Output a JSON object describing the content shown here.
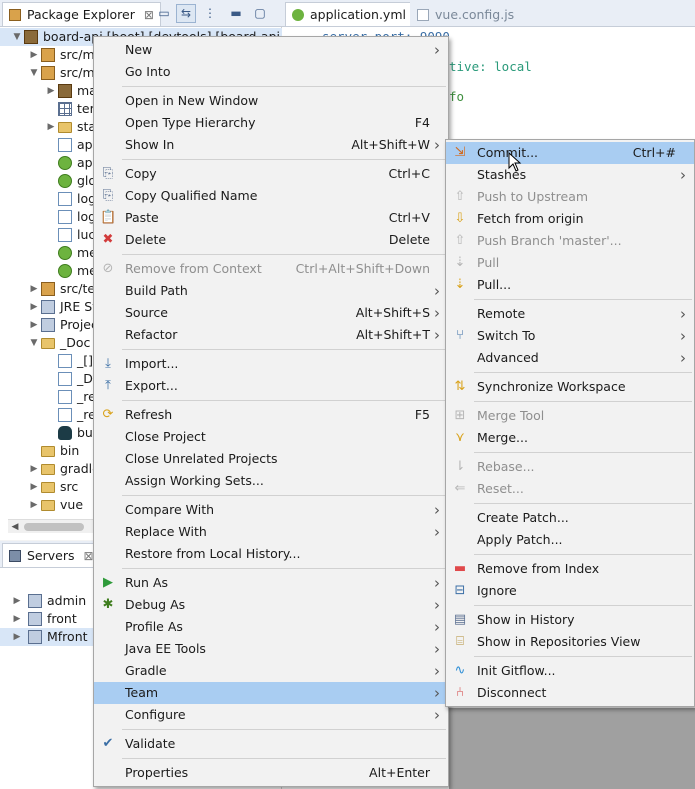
{
  "package_explorer": {
    "tab_label": "Package Explorer",
    "close_glyph": "⊠",
    "toolbar": [
      "collapse-all-icon",
      "link-with-editor-icon",
      "view-menu-icon",
      "minimize-icon",
      "maximize-icon"
    ],
    "tree": [
      {
        "text": "board-api [boot] [devtools] [board-api",
        "indent": 0,
        "twisty": "▼",
        "icon": "project-icon",
        "selected": true
      },
      {
        "text": "src/m",
        "indent": 1,
        "twisty": "▶",
        "icon": "source-folder-icon"
      },
      {
        "text": "src/m",
        "indent": 1,
        "twisty": "▼",
        "icon": "source-folder-icon"
      },
      {
        "text": "ma",
        "indent": 2,
        "twisty": "▶",
        "icon": "package-icon"
      },
      {
        "text": "ter",
        "indent": 2,
        "twisty": "",
        "icon": "grid-icon"
      },
      {
        "text": "sta",
        "indent": 2,
        "twisty": "▶",
        "icon": "folder-icon"
      },
      {
        "text": "ap",
        "indent": 2,
        "twisty": "",
        "icon": "file-icon"
      },
      {
        "text": "ap",
        "indent": 2,
        "twisty": "",
        "icon": "spring-icon"
      },
      {
        "text": "glo",
        "indent": 2,
        "twisty": "",
        "icon": "spring-icon"
      },
      {
        "text": "log",
        "indent": 2,
        "twisty": "",
        "icon": "file-icon"
      },
      {
        "text": "log",
        "indent": 2,
        "twisty": "",
        "icon": "xml-file-icon"
      },
      {
        "text": "luc",
        "indent": 2,
        "twisty": "",
        "icon": "file-icon"
      },
      {
        "text": "me",
        "indent": 2,
        "twisty": "",
        "icon": "spring-icon"
      },
      {
        "text": "me",
        "indent": 2,
        "twisty": "",
        "icon": "spring-icon"
      },
      {
        "text": "src/te",
        "indent": 1,
        "twisty": "▶",
        "icon": "source-folder-icon"
      },
      {
        "text": "JRE Sy",
        "indent": 1,
        "twisty": "▶",
        "icon": "library-icon"
      },
      {
        "text": "Projec",
        "indent": 1,
        "twisty": "▶",
        "icon": "library-icon"
      },
      {
        "text": "_Doc",
        "indent": 1,
        "twisty": "▼",
        "icon": "folder-icon"
      },
      {
        "text": "_[]",
        "indent": 2,
        "twisty": "",
        "icon": "file-icon"
      },
      {
        "text": "_D",
        "indent": 2,
        "twisty": "",
        "icon": "xml-file-icon"
      },
      {
        "text": "_re",
        "indent": 2,
        "twisty": "",
        "icon": "file-icon"
      },
      {
        "text": "_re",
        "indent": 2,
        "twisty": "",
        "icon": "file-icon"
      },
      {
        "text": "bu",
        "indent": 2,
        "twisty": "",
        "icon": "gradle-icon"
      },
      {
        "text": "bin",
        "indent": 1,
        "twisty": "",
        "icon": "folder-icon"
      },
      {
        "text": "gradle",
        "indent": 1,
        "twisty": "▶",
        "icon": "folder-icon"
      },
      {
        "text": "src",
        "indent": 1,
        "twisty": "▶",
        "icon": "folder-icon"
      },
      {
        "text": "vue",
        "indent": 1,
        "twisty": "▶",
        "icon": "folder-icon"
      }
    ]
  },
  "servers": {
    "tab_label": "Servers",
    "close_glyph": "⊠",
    "items": [
      {
        "text": "admin",
        "suffix": "[",
        "icon": "server-icon"
      },
      {
        "text": "front",
        "suffix": "[S",
        "icon": "server-icon"
      },
      {
        "text": "Mfront",
        "suffix": "",
        "icon": "server-icon",
        "selected": true
      }
    ]
  },
  "editor": {
    "tabs": [
      {
        "label": "application.yml",
        "close_glyph": "⊠",
        "active": true
      },
      {
        "label": "vue.config.js",
        "active": false
      }
    ],
    "code_lines": [
      {
        "text": "server.port: 9090",
        "kind": "key"
      },
      {
        "text": "tive: local",
        "kind": "value"
      },
      {
        "text": "fo",
        "kind": "comment"
      }
    ]
  },
  "context_menu": {
    "groups": [
      [
        {
          "label": "New",
          "submenu": true
        },
        {
          "label": "Go Into"
        }
      ],
      [
        {
          "label": "Open in New Window"
        },
        {
          "label": "Open Type Hierarchy",
          "shortcut": "F4"
        },
        {
          "label": "Show In",
          "shortcut": "Alt+Shift+W",
          "submenu": true
        }
      ],
      [
        {
          "label": "Copy",
          "shortcut": "Ctrl+C",
          "icon": "copy-icon"
        },
        {
          "label": "Copy Qualified Name",
          "icon": "copy-icon"
        },
        {
          "label": "Paste",
          "shortcut": "Ctrl+V",
          "icon": "paste-icon"
        },
        {
          "label": "Delete",
          "shortcut": "Delete",
          "icon": "delete-icon"
        }
      ],
      [
        {
          "label": "Remove from Context",
          "shortcut": "Ctrl+Alt+Shift+Down",
          "disabled": true,
          "icon": "remove-context-icon"
        },
        {
          "label": "Build Path",
          "submenu": true
        },
        {
          "label": "Source",
          "shortcut": "Alt+Shift+S",
          "submenu": true
        },
        {
          "label": "Refactor",
          "shortcut": "Alt+Shift+T",
          "submenu": true
        }
      ],
      [
        {
          "label": "Import...",
          "icon": "import-icon"
        },
        {
          "label": "Export...",
          "icon": "export-icon"
        }
      ],
      [
        {
          "label": "Refresh",
          "shortcut": "F5",
          "icon": "refresh-icon"
        },
        {
          "label": "Close Project"
        },
        {
          "label": "Close Unrelated Projects"
        },
        {
          "label": "Assign Working Sets..."
        }
      ],
      [
        {
          "label": "Compare With",
          "submenu": true
        },
        {
          "label": "Replace With",
          "submenu": true
        },
        {
          "label": "Restore from Local History..."
        }
      ],
      [
        {
          "label": "Run As",
          "submenu": true,
          "icon": "run-icon"
        },
        {
          "label": "Debug As",
          "submenu": true,
          "icon": "debug-icon"
        },
        {
          "label": "Profile As",
          "submenu": true
        },
        {
          "label": "Java EE Tools",
          "submenu": true
        },
        {
          "label": "Gradle",
          "submenu": true
        },
        {
          "label": "Team",
          "submenu": true,
          "selected": true
        },
        {
          "label": "Configure",
          "submenu": true
        }
      ],
      [
        {
          "label": "Validate",
          "icon": "check-icon"
        }
      ],
      [
        {
          "label": "Properties",
          "shortcut": "Alt+Enter"
        }
      ]
    ]
  },
  "team_submenu": {
    "groups": [
      [
        {
          "label": "Commit...",
          "shortcut": "Ctrl+#",
          "selected": true,
          "icon": "commit-icon"
        },
        {
          "label": "Stashes",
          "submenu": true
        },
        {
          "label": "Push to Upstream",
          "disabled": true,
          "icon": "push-icon"
        },
        {
          "label": "Fetch from origin",
          "icon": "fetch-icon"
        },
        {
          "label": "Push Branch 'master'...",
          "disabled": true,
          "icon": "push-icon"
        },
        {
          "label": "Pull",
          "disabled": true,
          "icon": "pull-icon"
        },
        {
          "label": "Pull...",
          "icon": "pull-icon"
        }
      ],
      [
        {
          "label": "Remote",
          "submenu": true
        },
        {
          "label": "Switch To",
          "submenu": true,
          "icon": "switch-branch-icon"
        },
        {
          "label": "Advanced",
          "submenu": true
        }
      ],
      [
        {
          "label": "Synchronize Workspace",
          "icon": "synchronize-icon"
        }
      ],
      [
        {
          "label": "Merge Tool",
          "disabled": true,
          "icon": "merge-tool-icon"
        },
        {
          "label": "Merge...",
          "icon": "merge-icon"
        }
      ],
      [
        {
          "label": "Rebase...",
          "disabled": true,
          "icon": "rebase-icon"
        },
        {
          "label": "Reset...",
          "disabled": true,
          "icon": "reset-icon"
        }
      ],
      [
        {
          "label": "Create Patch..."
        },
        {
          "label": "Apply Patch..."
        }
      ],
      [
        {
          "label": "Remove from Index",
          "icon": "remove-index-icon"
        },
        {
          "label": "Ignore",
          "icon": "ignore-icon"
        }
      ],
      [
        {
          "label": "Show in History",
          "icon": "history-icon"
        },
        {
          "label": "Show in Repositories View",
          "icon": "repositories-icon"
        }
      ],
      [
        {
          "label": "Init Gitflow...",
          "icon": "gitflow-icon"
        },
        {
          "label": "Disconnect",
          "icon": "disconnect-icon"
        }
      ]
    ]
  },
  "icon_glyphs": {
    "copy-icon": "⎘",
    "paste-icon": "📋",
    "delete-icon": "✖",
    "remove-context-icon": "⊘",
    "import-icon": "⤓",
    "export-icon": "⤒",
    "refresh-icon": "⟳",
    "run-icon": "▶",
    "debug-icon": "✱",
    "check-icon": "✔",
    "commit-icon": "⇲",
    "push-icon": "⇧",
    "fetch-icon": "⇩",
    "pull-icon": "⇣",
    "switch-branch-icon": "⑂",
    "synchronize-icon": "⇅",
    "merge-tool-icon": "⊞",
    "merge-icon": "⋎",
    "rebase-icon": "⇂",
    "reset-icon": "⇐",
    "remove-index-icon": "▬",
    "ignore-icon": "⊟",
    "history-icon": "▤",
    "repositories-icon": "⌸",
    "gitflow-icon": "∿",
    "disconnect-icon": "⑃"
  },
  "icon_colors": {
    "delete-icon": "#d23b3b",
    "run-icon": "#2e9a3a",
    "debug-icon": "#3f7d1e",
    "check-icon": "#3a6ea5",
    "commit-icon": "#d2691e",
    "fetch-icon": "#d9a21b",
    "pull-icon": "#d9a21b",
    "remove-index-icon": "#e0494b",
    "gitflow-icon": "#2f8fd6",
    "disconnect-icon": "#d23b3b",
    "synchronize-icon": "#d9a21b",
    "merge-icon": "#d9a21b",
    "refresh-icon": "#d9a21b",
    "import-icon": "#3a6ea5",
    "export-icon": "#3a6ea5",
    "switch-branch-icon": "#3a6ea5",
    "history-icon": "#5a6f90",
    "repositories-icon": "#b08b2e",
    "ignore-icon": "#3a6ea5",
    "copy-icon": "#5a6f90",
    "paste-icon": "#5a6f90"
  },
  "colors": {
    "selection": "#a9cdf2",
    "menu_bg": "#f2f2f2",
    "disabled_text": "#8f8f8f"
  }
}
